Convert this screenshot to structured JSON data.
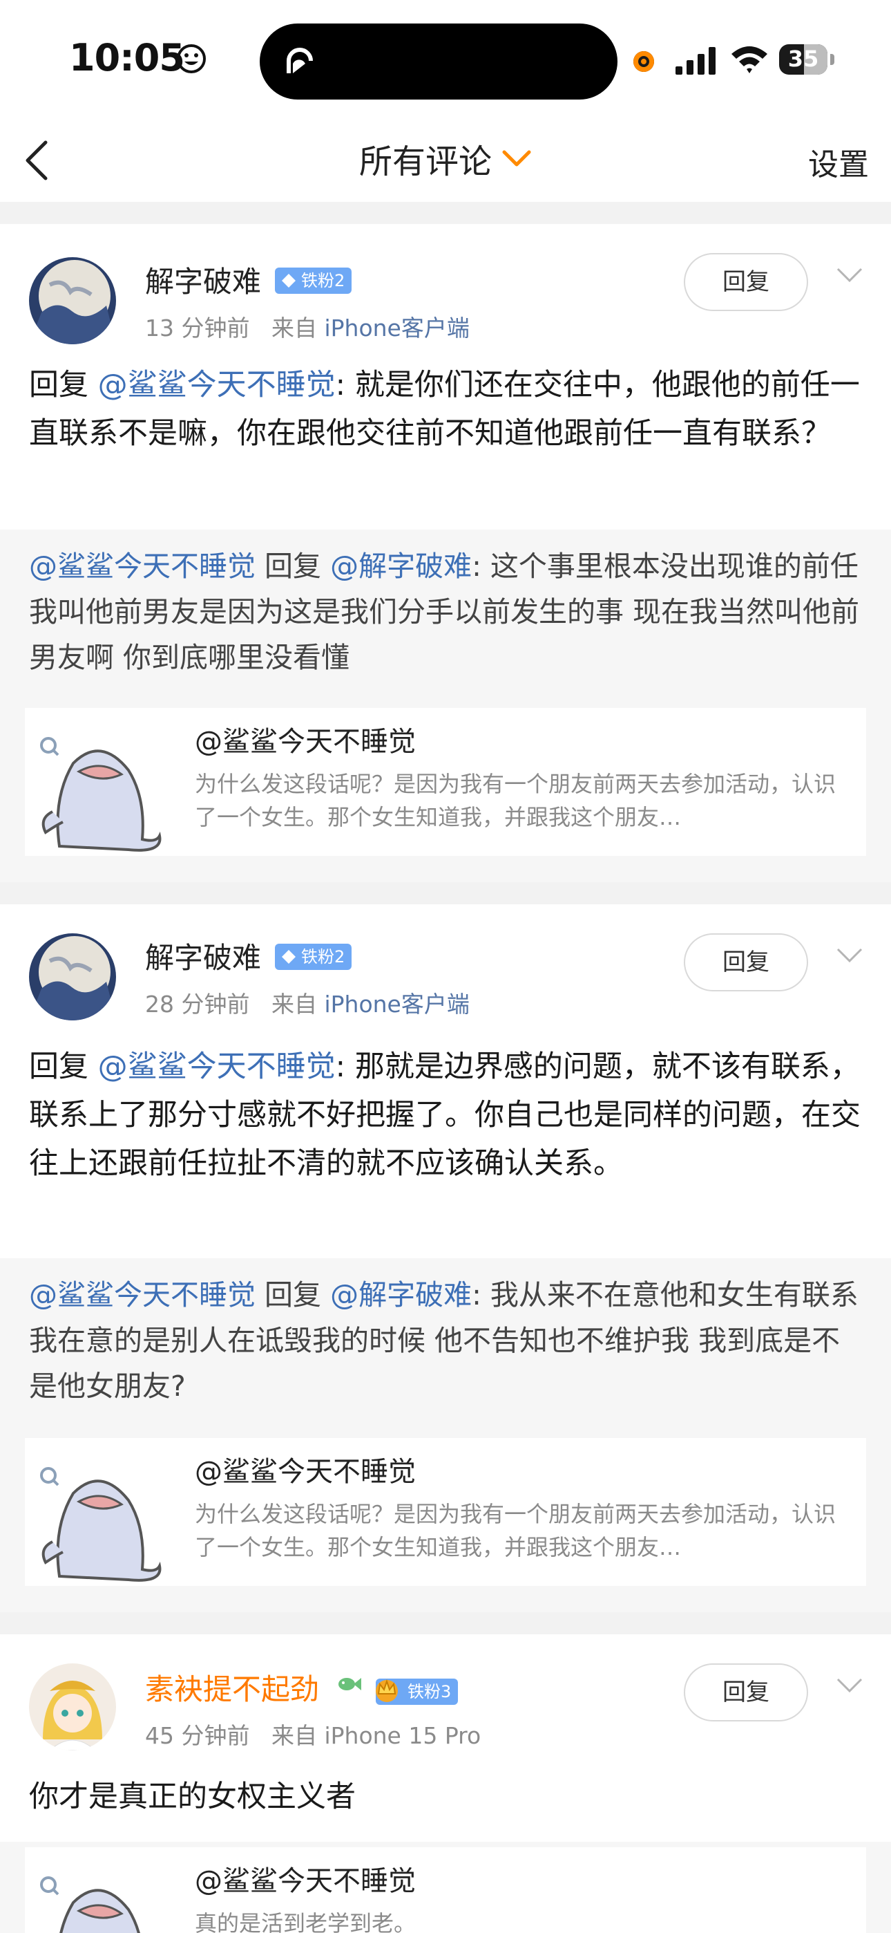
{
  "status_bar": {
    "time": "10:05",
    "battery": "35",
    "icons": [
      "smiley-icon",
      "activity-icon",
      "recording-dot-icon",
      "signal-icon",
      "wifi-icon",
      "battery-icon"
    ]
  },
  "nav": {
    "title": "所有评论",
    "settings": "设置",
    "accent_color": "#ff8a00"
  },
  "comments": [
    {
      "username": "解字破难",
      "badge": "铁粉2",
      "time": "13 分钟前",
      "source_prefix": "来自",
      "source": "iPhone客户端",
      "reply_label": "回复",
      "body_prefix": "回复 ",
      "body_mention": "@鲨鲨今天不睡觉",
      "body_text": ": 就是你们还在交往中，他跟他的前任一直联系不是嘛，你在跟他交往前不知道他跟前任一直有联系？",
      "quote_mention1": "@鲨鲨今天不睡觉",
      "quote_reply": " 回复 ",
      "quote_mention2": "@解字破难",
      "quote_text": ": 这个事里根本没出现谁的前任 我叫他前男友是因为这是我们分手以前发生的事 现在我当然叫他前男友啊 你到底哪里没看懂",
      "orig_name": "@鲨鲨今天不睡觉",
      "orig_snippet": "为什么发这段话呢？是因为我有一个朋友前两天去参加活动，认识了一个女生。那个女生知道我，并跟我这个朋友…"
    },
    {
      "username": "解字破难",
      "badge": "铁粉2",
      "time": "28 分钟前",
      "source_prefix": "来自",
      "source": "iPhone客户端",
      "reply_label": "回复",
      "body_prefix": "回复 ",
      "body_mention": "@鲨鲨今天不睡觉",
      "body_text": ": 那就是边界感的问题，就不该有联系，联系上了那分寸感就不好把握了。你自己也是同样的问题，在交往上还跟前任拉扯不清的就不应该确认关系。",
      "quote_mention1": "@鲨鲨今天不睡觉",
      "quote_reply": " 回复 ",
      "quote_mention2": "@解字破难",
      "quote_text": ": 我从来不在意他和女生有联系 我在意的是别人在诋毁我的时候 他不告知也不维护我 我到底是不是他女朋友?",
      "orig_name": "@鲨鲨今天不睡觉",
      "orig_snippet": "为什么发这段话呢？是因为我有一个朋友前两天去参加活动，认识了一个女生。那个女生知道我，并跟我这个朋友…"
    },
    {
      "username": "素袂提不起劲",
      "badge": "铁粉3",
      "time": "45 分钟前",
      "source_prefix": "来自",
      "source": "iPhone 15 Pro",
      "reply_label": "回复",
      "body_text": "你才是真正的女权主义者",
      "orig_name": "@鲨鲨今天不睡觉",
      "orig_snippet": "真的是活到老学到老。"
    }
  ]
}
